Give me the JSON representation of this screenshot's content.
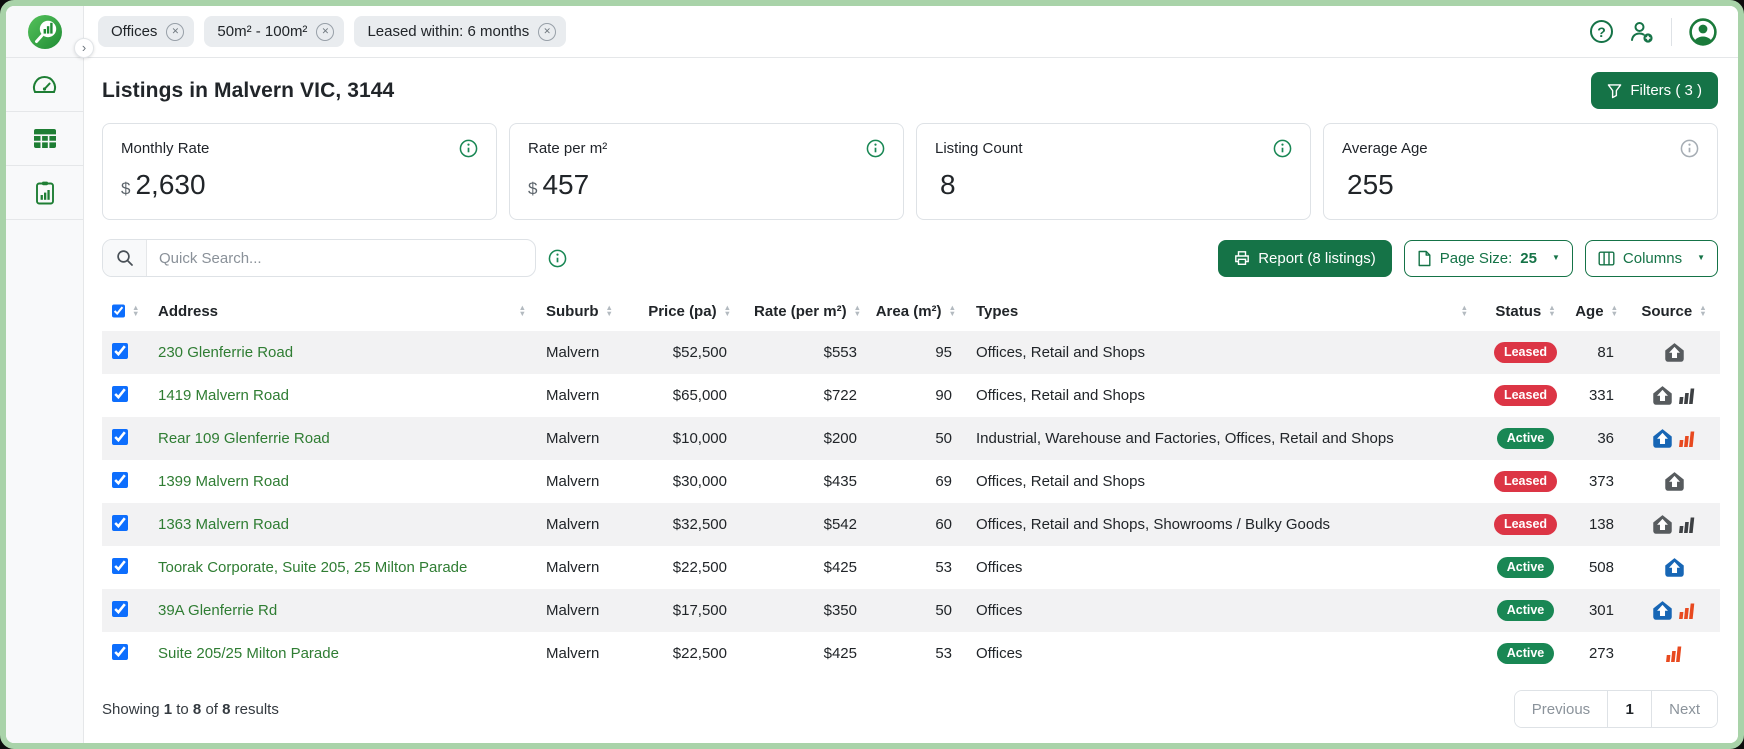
{
  "theme": {
    "brand_green": "#157347",
    "link_green": "#2f7d33",
    "badge_active_green": "#198754",
    "badge_leased_red": "#dc3545",
    "frame_green": "#a9d3a9",
    "checkbox_blue": "#0d6efd",
    "source_house_gray": "#575b5e",
    "source_house_blue": "#1766b5",
    "source_bars_dark": "#3d4043",
    "source_bars_orange": "#e8491f"
  },
  "topbar": {
    "filter_chips": [
      {
        "label": "Offices"
      },
      {
        "label": "50m² - 100m²"
      },
      {
        "label": "Leased within: 6 months"
      }
    ],
    "icons": [
      "help-icon",
      "add-user-icon",
      "avatar-icon"
    ]
  },
  "sidebar": {
    "icons": [
      "logo-search-buildings",
      "dashboard-gauge-icon",
      "listings-grid-icon",
      "report-clipboard-icon"
    ]
  },
  "header": {
    "title": "Listings in Malvern VIC, 3144",
    "filters_button_label": "Filters ( 3 )"
  },
  "stats": {
    "cards": [
      {
        "label": "Monthly Rate",
        "prefix": "$",
        "value": "2,630"
      },
      {
        "label": "Rate per m²",
        "prefix": "$",
        "value": "457"
      },
      {
        "label": "Listing Count",
        "prefix": "",
        "value": "8"
      },
      {
        "label": "Average Age",
        "prefix": "",
        "value": "255"
      }
    ]
  },
  "toolbar": {
    "search_placeholder": "Quick Search...",
    "report_button": "Report (8 listings)",
    "page_size_label": "Page Size:",
    "page_size_value": "25",
    "columns_button": "Columns"
  },
  "table": {
    "headers": {
      "address": "Address",
      "suburb": "Suburb",
      "price": "Price (pa)",
      "rate": "Rate (per m²)",
      "area": "Area (m²)",
      "types": "Types",
      "status": "Status",
      "age": "Age",
      "source": "Source"
    },
    "all_selected": true,
    "rows": [
      {
        "selected": true,
        "address": "230 Glenferrie Road",
        "suburb": "Malvern",
        "price": "$52,500",
        "rate": "$553",
        "area": "95",
        "types": "Offices, Retail and Shops",
        "status": "Leased",
        "age": "81",
        "sources": [
          "house-gray"
        ]
      },
      {
        "selected": true,
        "address": "1419 Malvern Road",
        "suburb": "Malvern",
        "price": "$65,000",
        "rate": "$722",
        "area": "90",
        "types": "Offices, Retail and Shops",
        "status": "Leased",
        "age": "331",
        "sources": [
          "house-gray",
          "bars-dark"
        ]
      },
      {
        "selected": true,
        "address": "Rear 109 Glenferrie Road",
        "suburb": "Malvern",
        "price": "$10,000",
        "rate": "$200",
        "area": "50",
        "types": "Industrial, Warehouse and Factories, Offices, Retail and Shops",
        "status": "Active",
        "age": "36",
        "sources": [
          "house-blue",
          "bars-orange"
        ]
      },
      {
        "selected": true,
        "address": "1399 Malvern Road",
        "suburb": "Malvern",
        "price": "$30,000",
        "rate": "$435",
        "area": "69",
        "types": "Offices, Retail and Shops",
        "status": "Leased",
        "age": "373",
        "sources": [
          "house-gray"
        ]
      },
      {
        "selected": true,
        "address": "1363 Malvern Road",
        "suburb": "Malvern",
        "price": "$32,500",
        "rate": "$542",
        "area": "60",
        "types": "Offices, Retail and Shops, Showrooms / Bulky Goods",
        "status": "Leased",
        "age": "138",
        "sources": [
          "house-gray",
          "bars-dark"
        ]
      },
      {
        "selected": true,
        "address": "Toorak Corporate, Suite 205, 25 Milton Parade",
        "suburb": "Malvern",
        "price": "$22,500",
        "rate": "$425",
        "area": "53",
        "types": "Offices",
        "status": "Active",
        "age": "508",
        "sources": [
          "house-blue"
        ]
      },
      {
        "selected": true,
        "address": "39A Glenferrie Rd",
        "suburb": "Malvern",
        "price": "$17,500",
        "rate": "$350",
        "area": "50",
        "types": "Offices",
        "status": "Active",
        "age": "301",
        "sources": [
          "house-blue",
          "bars-orange"
        ]
      },
      {
        "selected": true,
        "address": "Suite 205/25 Milton Parade",
        "suburb": "Malvern",
        "price": "$22,500",
        "rate": "$425",
        "area": "53",
        "types": "Offices",
        "status": "Active",
        "age": "273",
        "sources": [
          "bars-orange"
        ]
      }
    ]
  },
  "footer": {
    "showing_prefix": "Showing",
    "from": "1",
    "to_word": "to",
    "to": "8",
    "of_word": "of",
    "total": "8",
    "results_word": "results",
    "previous_label": "Previous",
    "current_page": "1",
    "next_label": "Next"
  }
}
